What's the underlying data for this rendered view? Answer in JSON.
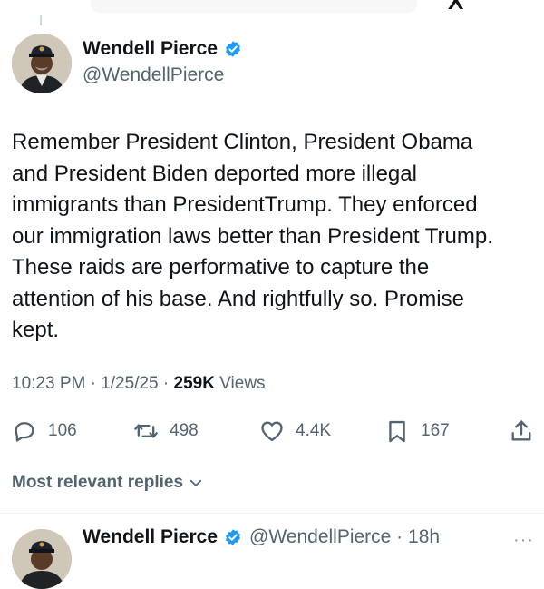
{
  "header": {
    "logo_text": "X"
  },
  "tweet": {
    "author_name": "Wendell Pierce",
    "author_handle": "@WendellPierce",
    "text": "Remember President Clinton, President Obama\nand President Biden deported more illegal\nimmigrants than PresidentTrump. They enforced\nour immigration laws better than President Trump.\nThese raids are performative to capture the\nattention of his base. And rightfully so. Promise\nkept.",
    "timestamp": "10:23 PM · 1/25/25 · ",
    "views_count": "259K",
    "views_label": " Views"
  },
  "actions": {
    "reply_count": "106",
    "retweet_count": "498",
    "like_count": "4.4K",
    "bookmark_count": "167"
  },
  "replies_filter": {
    "label": "Most relevant replies"
  },
  "reply_preview": {
    "author_name": "Wendell Pierce",
    "meta": "@WendellPierce · 18h",
    "more": "···"
  },
  "colors": {
    "verified": "#1d9bf0",
    "muted": "#536471",
    "text": "#0f1419"
  },
  "icons": [
    "reply-icon",
    "retweet-icon",
    "like-icon",
    "bookmark-icon",
    "share-icon",
    "verified-badge-icon",
    "chevron-down-icon"
  ]
}
